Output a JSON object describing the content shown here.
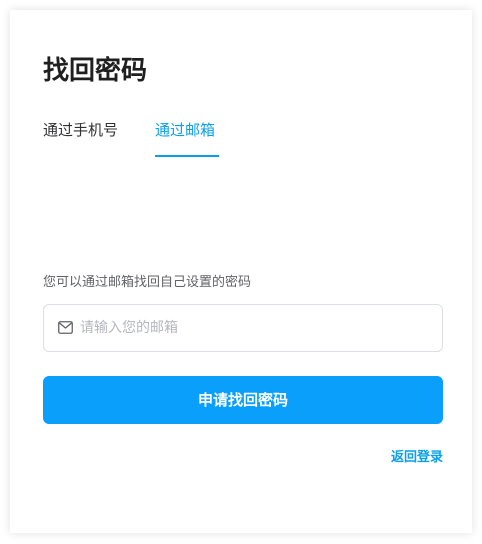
{
  "page": {
    "title": "找回密码"
  },
  "tabs": [
    {
      "label": "通过手机号",
      "active": false
    },
    {
      "label": "通过邮箱",
      "active": true
    }
  ],
  "form": {
    "hint": "您可以通过邮箱找回自己设置的密码",
    "email_placeholder": "请输入您的邮箱",
    "email_value": "",
    "email_icon": "mail-icon",
    "submit_label": "申请找回密码"
  },
  "links": {
    "back_to_login": "返回登录"
  },
  "colors": {
    "accent": "#0a9fea",
    "button": "#0a9ffb",
    "text_primary": "#1f1f1f",
    "text_secondary": "#606266",
    "placeholder": "#b4b7bd",
    "border": "#dcdfe6"
  }
}
